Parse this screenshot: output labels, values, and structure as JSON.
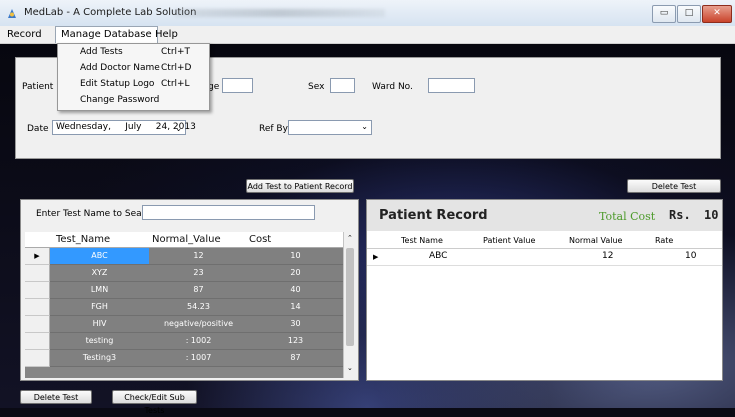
{
  "window": {
    "title": "MedLab - A Complete Lab Solution",
    "minimize_glyph": "▭",
    "maximize_glyph": "□",
    "close_glyph": "✕"
  },
  "menubar": {
    "items": [
      "Record",
      "Manage Database",
      "Help"
    ]
  },
  "dropdown": {
    "items": [
      {
        "label": "Add Tests",
        "shortcut": "Ctrl+T"
      },
      {
        "label": "Add Doctor Name",
        "shortcut": "Ctrl+D"
      },
      {
        "label": "Edit Statup Logo",
        "shortcut": "Ctrl+L"
      },
      {
        "label": "Change Password",
        "shortcut": ""
      }
    ]
  },
  "patient_form": {
    "patient_label": "Patient",
    "age_label_fragment": "ge",
    "sex_label": "Sex",
    "ward_label": "Ward No.",
    "date_label": "Date",
    "date_value": "Wednesday,     July     24, 2013",
    "ref_by_label": "Ref By",
    "ref_by_value": ""
  },
  "buttons": {
    "add_test": "Add Test to Patient Record",
    "delete_test_right": "Delete Test",
    "delete_test_left": "Delete Test",
    "check_edit_sub": "Check/Edit Sub Tests"
  },
  "search": {
    "label": "Enter Test Name to Search",
    "value": ""
  },
  "tests_grid": {
    "columns": [
      "Test_Name",
      "Normal_Value",
      "Cost"
    ],
    "selected_row_marker": "▶",
    "rows": [
      [
        "ABC",
        "12",
        "10"
      ],
      [
        "XYZ",
        "23",
        "20"
      ],
      [
        "LMN",
        "87",
        "40"
      ],
      [
        "FGH",
        "54.23",
        "14"
      ],
      [
        "HIV",
        "negative/positive",
        "30"
      ],
      [
        "testing",
        ": 1002",
        "123"
      ],
      [
        "Testing3",
        ": 1007",
        "87"
      ]
    ]
  },
  "patient_record": {
    "title": "Patient Record",
    "total_cost_label": "Total Cost",
    "currency": "Rs.",
    "total_value": "10",
    "columns": [
      "Test Name",
      "Patient Value",
      "Normal Value",
      "Rate"
    ],
    "row_marker": "▶",
    "rows": [
      [
        "ABC",
        "",
        "12",
        "10"
      ]
    ]
  },
  "colors": {
    "selected_row": "#3399ff",
    "total_cost_label": "#4c9a2a",
    "grid_cell": "#808080"
  }
}
